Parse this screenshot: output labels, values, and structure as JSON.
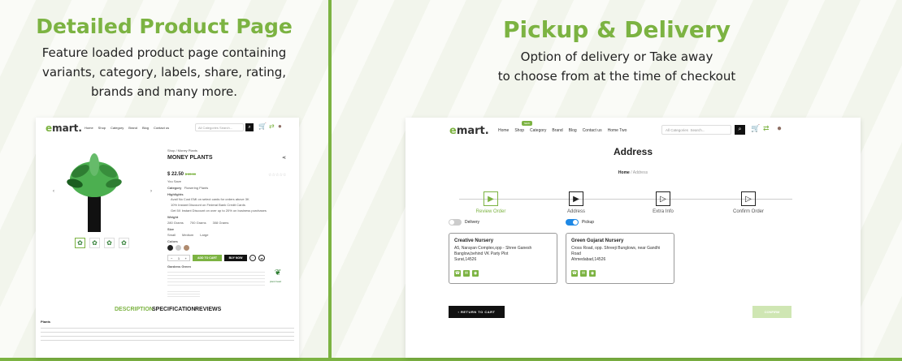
{
  "left": {
    "title": "Detailed Product Page",
    "description": [
      "Feature loaded product page containing",
      "variants, category, labels, share, rating,",
      "brands and many more."
    ],
    "mock": {
      "logo_e": "e",
      "logo_rest": "mart.",
      "nav": [
        "Home",
        "Shop",
        "Category",
        "Brand",
        "Blog",
        "Contact us"
      ],
      "search_category": "All Categories",
      "search_placeholder": "Search...",
      "breadcrumb": "Shop / Money Plants",
      "product_name": "MONEY PLANTS",
      "price": "$ 22.50",
      "old_price": "$ 35.00",
      "you_save_label": "You Save",
      "category_label": "Category",
      "category_value": "Flowering Plants",
      "highlights_label": "Highlights",
      "highlights": [
        "Avail No Cost EMI on select cards for orders above 3K",
        "10% Instant Discount on Federal Bank Credit Cards",
        "Get 5X Instant Discount on over up to 20% on business purchases"
      ],
      "weight_label": "Weight",
      "weights": [
        "280 Grams",
        "700 Grams",
        "308 Grams"
      ],
      "size_label": "Size",
      "sizes": [
        "Small",
        "Medium",
        "Large"
      ],
      "colors_label": "Colors",
      "swatches": [
        "#222222",
        "#c9c9c9",
        "#b08b6f"
      ],
      "qty": "1",
      "add_to_cart": "ADD TO CART",
      "buy_now": "BUY NOW",
      "brand_section": "Gardens Green",
      "brand_name": "plant head",
      "tabs": [
        "DESCRIPTION",
        "SPECIFICATION",
        "REVIEWS"
      ],
      "body_start": "Plants"
    }
  },
  "right": {
    "title": "Pickup & Delivery",
    "description": [
      "Option of delivery or Take away",
      "to choose from at the time of checkout"
    ],
    "mock": {
      "logo_e": "e",
      "logo_rest": "mart.",
      "nav": [
        "Home",
        "Shop",
        "Category",
        "Brand",
        "Blog",
        "Contact us",
        "Home Two"
      ],
      "nav_badge": "NEW",
      "search_category": "All Categories",
      "search_placeholder": "Search...",
      "page_title": "Address",
      "breadcrumb_home": "Home",
      "breadcrumb_current": "Address",
      "steps": [
        {
          "label": "Review Order",
          "active": true
        },
        {
          "label": "Address",
          "active": false
        },
        {
          "label": "Extra Info",
          "active": false
        },
        {
          "label": "Confirm Order",
          "active": false
        }
      ],
      "delivery_label": "Delivery",
      "pickup_label": "Pickup",
      "cards": [
        {
          "name": "Creative Nursery",
          "address": [
            "A5, Narayan Complex,opp - Shree Ganesh",
            "Banglow,behind VK Party Plot",
            "Surat,14526"
          ]
        },
        {
          "name": "Green Gujarat Nursery",
          "address": [
            "Cross Road, opp. Shreeji Bunglows, near Gandhi",
            "Road",
            "Ahmedabad,14526"
          ]
        }
      ],
      "return_btn": "RETURN TO CART",
      "continue_btn": "CONFIRM"
    }
  },
  "colors": {
    "accent": "#7cb342",
    "dark": "#111111",
    "toggle_on": "#1e88e5"
  }
}
